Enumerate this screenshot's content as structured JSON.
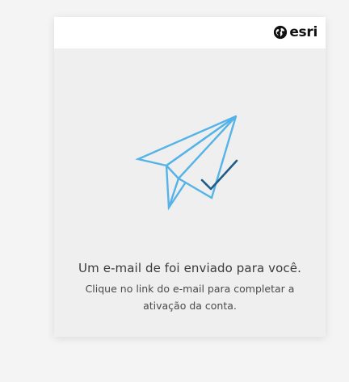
{
  "brand": {
    "logo_text": "esri",
    "logo_icon": "globe-icon"
  },
  "illustration": {
    "icon": "paper-plane-check-icon",
    "colors": {
      "plane": "#55b3e8",
      "check": "#1f5c8a"
    }
  },
  "message": {
    "title": "Um e-mail de foi enviado para você.",
    "body": "Clique no link do e-mail para completar a ativação da conta."
  },
  "colors": {
    "page_background": "#f4f4f4",
    "card_background": "#efefef",
    "header_background": "#ffffff"
  }
}
